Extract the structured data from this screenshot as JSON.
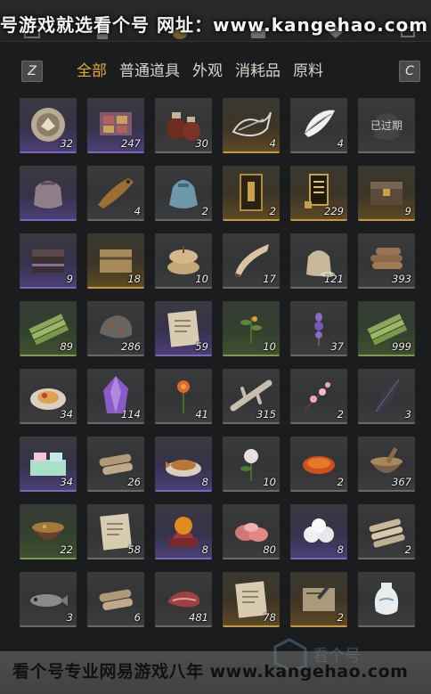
{
  "watermark_top": "号游戏就选看个号  网址：www.kangehao.com",
  "watermark_bottom": "看个号专业网易游戏八年  www.kangehao.com",
  "logo_text": "看个号",
  "hints": {
    "left_key": "Z",
    "right_key": "C"
  },
  "tabs": [
    {
      "label": "全部",
      "active": true
    },
    {
      "label": "普通道具",
      "active": false
    },
    {
      "label": "外观",
      "active": false
    },
    {
      "label": "消耗品",
      "active": false
    },
    {
      "label": "原料",
      "active": false
    }
  ],
  "items": [
    {
      "icon": "medal-coin-icon",
      "quality": "purple",
      "count": "32"
    },
    {
      "icon": "gift-box-icon",
      "quality": "purple",
      "count": "247"
    },
    {
      "icon": "wine-jars-icon",
      "quality": "grey",
      "count": "30"
    },
    {
      "icon": "dragon-outline-icon",
      "quality": "gold",
      "count": "4"
    },
    {
      "icon": "feather-tuft-icon",
      "quality": "grey",
      "count": "4"
    },
    {
      "icon": "pouch-icon",
      "quality": "grey",
      "count": "",
      "label": "已过期"
    },
    {
      "icon": "cloth-bag-icon",
      "quality": "purple",
      "count": ""
    },
    {
      "icon": "fish-icon",
      "quality": "grey",
      "count": "4"
    },
    {
      "icon": "blue-sack-icon",
      "quality": "grey",
      "count": "2"
    },
    {
      "icon": "scroll-card-icon",
      "quality": "gold",
      "count": "2"
    },
    {
      "icon": "token-tags-icon",
      "quality": "gold",
      "count": "229"
    },
    {
      "icon": "treasure-chest-icon",
      "quality": "gold",
      "count": "9"
    },
    {
      "icon": "dark-chest-icon",
      "quality": "purple",
      "count": "9"
    },
    {
      "icon": "wrapped-crate-icon",
      "quality": "gold",
      "count": "18"
    },
    {
      "icon": "grain-sacks-icon",
      "quality": "grey",
      "count": "10"
    },
    {
      "icon": "horn-icon",
      "quality": "grey",
      "count": "17"
    },
    {
      "icon": "flour-bag-icon",
      "quality": "grey",
      "count": "121"
    },
    {
      "icon": "log-bundle-icon",
      "quality": "grey",
      "count": "393"
    },
    {
      "icon": "bamboo-bundle-icon",
      "quality": "green",
      "count": "89"
    },
    {
      "icon": "ore-rock-icon",
      "quality": "grey",
      "count": "286"
    },
    {
      "icon": "recipe-paper-icon",
      "quality": "purple",
      "count": "59"
    },
    {
      "icon": "herb-sprig-icon",
      "quality": "green",
      "count": "10"
    },
    {
      "icon": "lavender-icon",
      "quality": "grey",
      "count": "37"
    },
    {
      "icon": "bamboo-bundle-icon",
      "quality": "green",
      "count": "999"
    },
    {
      "icon": "dish-plate-icon",
      "quality": "grey",
      "count": "34"
    },
    {
      "icon": "purple-crystal-icon",
      "quality": "grey",
      "count": "114"
    },
    {
      "icon": "orange-flower-icon",
      "quality": "grey",
      "count": "41"
    },
    {
      "icon": "bone-branch-icon",
      "quality": "grey",
      "count": "315"
    },
    {
      "icon": "blossom-branch-icon",
      "quality": "grey",
      "count": "2"
    },
    {
      "icon": "black-feather-icon",
      "quality": "grey",
      "count": "3"
    },
    {
      "icon": "cake-box-icon",
      "quality": "purple",
      "count": "34"
    },
    {
      "icon": "wood-logs-icon",
      "quality": "grey",
      "count": "26"
    },
    {
      "icon": "fried-fish-icon",
      "quality": "purple",
      "count": "8"
    },
    {
      "icon": "white-flower-icon",
      "quality": "grey",
      "count": "10"
    },
    {
      "icon": "red-slice-icon",
      "quality": "grey",
      "count": "2"
    },
    {
      "icon": "mortar-bowl-icon",
      "quality": "grey",
      "count": "367"
    },
    {
      "icon": "stew-pot-icon",
      "quality": "green",
      "count": "22"
    },
    {
      "icon": "recipe-paper-icon",
      "quality": "grey",
      "count": "58"
    },
    {
      "icon": "orb-stand-icon",
      "quality": "purple",
      "count": "8"
    },
    {
      "icon": "raw-meat-icon",
      "quality": "grey",
      "count": "80"
    },
    {
      "icon": "dumplings-icon",
      "quality": "purple",
      "count": "8"
    },
    {
      "icon": "log-pile-icon",
      "quality": "grey",
      "count": "2"
    },
    {
      "icon": "grey-fish-icon",
      "quality": "grey",
      "count": "3"
    },
    {
      "icon": "wood-logs-icon",
      "quality": "grey",
      "count": "6"
    },
    {
      "icon": "meat-chunk-icon",
      "quality": "grey",
      "count": "481"
    },
    {
      "icon": "recipe-paper-icon",
      "quality": "gold",
      "count": "78"
    },
    {
      "icon": "letter-paper-icon",
      "quality": "gold",
      "count": "2"
    },
    {
      "icon": "porcelain-vase-icon",
      "quality": "grey",
      "count": ""
    }
  ]
}
